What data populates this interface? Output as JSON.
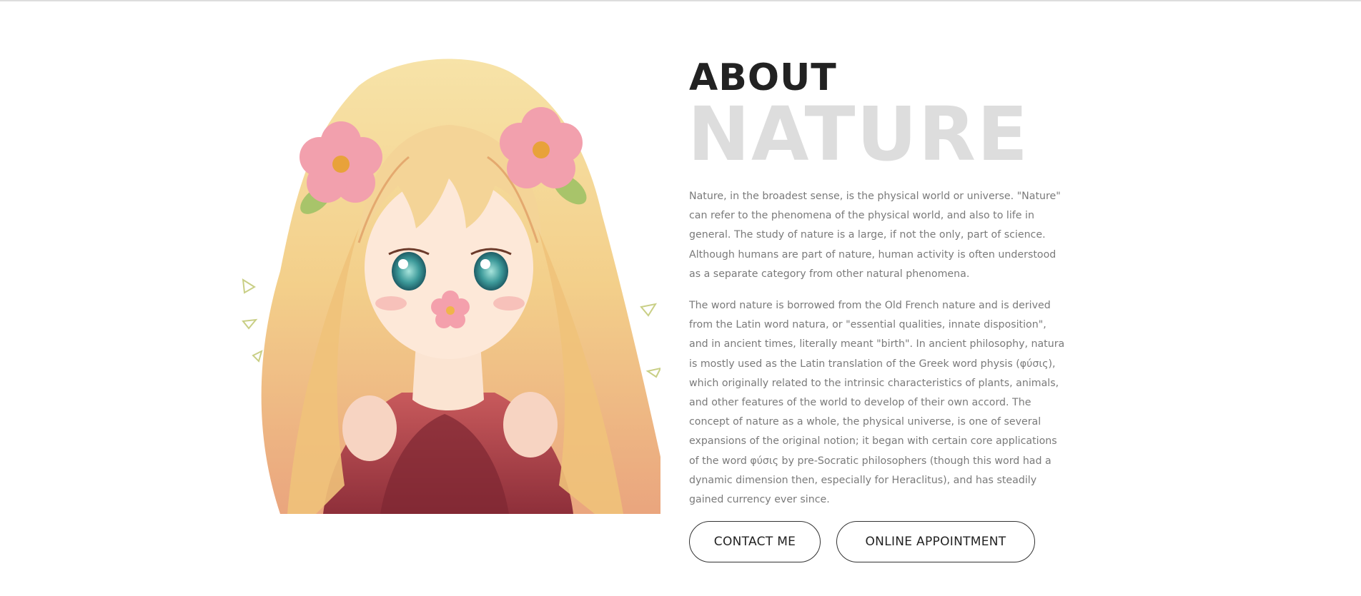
{
  "about": {
    "heading": "ABOUT",
    "subheading": "NATURE",
    "paragraphs": [
      "Nature, in the broadest sense, is the physical world or universe. \"Nature\" can refer to the phenomena of the physical world, and also to life in general. The study of nature is a large, if not the only, part of science. Although humans are part of nature, human activity is often understood as a separate category from other natural phenomena.",
      "The word nature is borrowed from the Old French nature and is derived from the Latin word natura, or \"essential qualities, innate disposition\", and in ancient times, literally meant \"birth\". In ancient philosophy, natura is mostly used as the Latin translation of the Greek word physis (φύσις), which originally related to the intrinsic characteristics of plants, animals, and other features of the world to develop of their own accord. The concept of nature as a whole, the physical universe, is one of several expansions of the original notion; it began with certain core applications of the word φύσις by pre-Socratic philosophers (though this word had a dynamic dimension then, especially for Heraclitus), and has steadily gained currency ever since."
    ]
  },
  "buttons": {
    "contact_label": "CONTACT ME",
    "appointment_label": "ONLINE APPOINTMENT"
  },
  "illustration": {
    "subject": "anime girl with blonde hair and pink flowers",
    "colors": {
      "hair": "#f3d58e",
      "hair_shade": "#e8a77a",
      "skin": "#fbe4d2",
      "flower": "#f2a0ad",
      "dress": "#b9484e",
      "eye": "#3d9a9a",
      "leaf": "#a8c46a"
    }
  }
}
